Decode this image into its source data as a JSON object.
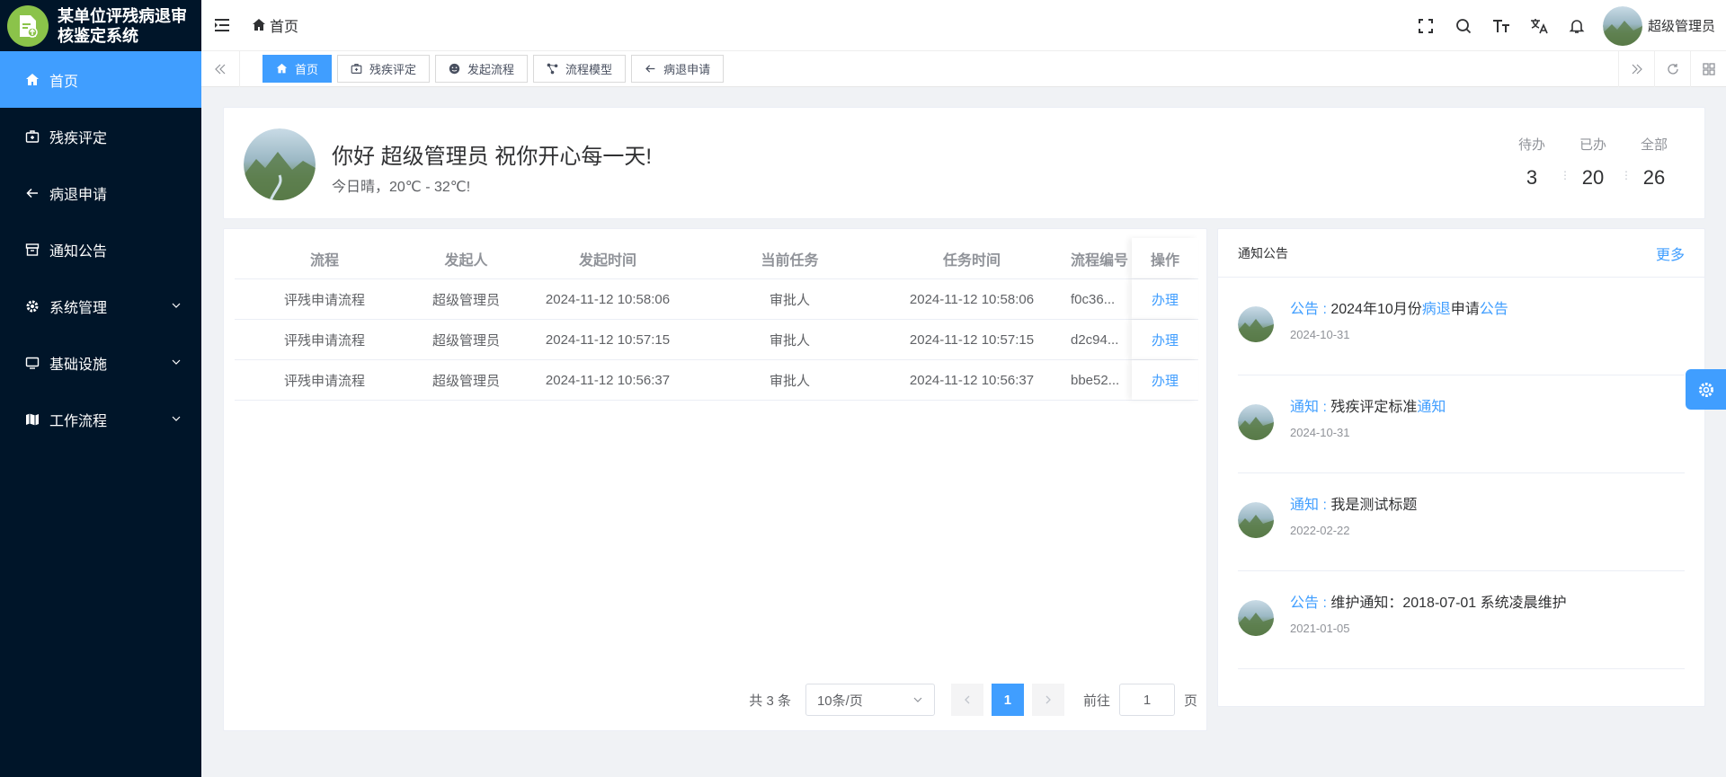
{
  "app": {
    "title": "某单位评残病退审核鉴定系统"
  },
  "sidebar": {
    "items": [
      {
        "label": "首页",
        "icon": "home-icon",
        "active": true
      },
      {
        "label": "残疾评定",
        "icon": "medkit-icon"
      },
      {
        "label": "病退申请",
        "icon": "arrow-left-icon"
      },
      {
        "label": "通知公告",
        "icon": "archive-icon"
      },
      {
        "label": "系统管理",
        "icon": "gear-icon",
        "expandable": true
      },
      {
        "label": "基础设施",
        "icon": "monitor-icon",
        "expandable": true
      },
      {
        "label": "工作流程",
        "icon": "map-icon",
        "expandable": true
      }
    ]
  },
  "header": {
    "breadcrumb": "首页",
    "user_name": "超级管理员",
    "tools": [
      "fullscreen-icon",
      "search-icon",
      "font-size-icon",
      "translate-icon",
      "bell-icon"
    ]
  },
  "tabs": [
    {
      "label": "首页",
      "active": true
    },
    {
      "label": "残疾评定"
    },
    {
      "label": "发起流程"
    },
    {
      "label": "流程模型"
    },
    {
      "label": "病退申请"
    }
  ],
  "welcome": {
    "greeting": "你好 超级管理员 祝你开心每一天!",
    "weather": "今日晴，20℃ - 32℃!",
    "stats": [
      {
        "label": "待办",
        "value": "3"
      },
      {
        "label": "已办",
        "value": "20"
      },
      {
        "label": "全部",
        "value": "26"
      }
    ]
  },
  "table": {
    "columns": [
      "流程",
      "发起人",
      "发起时间",
      "当前任务",
      "任务时间",
      "流程编号",
      "操作"
    ],
    "rows": [
      {
        "process": "评残申请流程",
        "initiator": "超级管理员",
        "start": "2024-11-12 10:58:06",
        "task": "审批人",
        "task_time": "2024-11-12 10:58:06",
        "code": "f0c36...",
        "action": "办理"
      },
      {
        "process": "评残申请流程",
        "initiator": "超级管理员",
        "start": "2024-11-12 10:57:15",
        "task": "审批人",
        "task_time": "2024-11-12 10:57:15",
        "code": "d2c94...",
        "action": "办理"
      },
      {
        "process": "评残申请流程",
        "initiator": "超级管理员",
        "start": "2024-11-12 10:56:37",
        "task": "审批人",
        "task_time": "2024-11-12 10:56:37",
        "code": "bbe52...",
        "action": "办理"
      }
    ],
    "pager": {
      "total": "共 3 条",
      "page_size": "10条/页",
      "current": "1",
      "goto_prefix": "前往",
      "goto_value": "1",
      "goto_suffix": "页"
    }
  },
  "notices": {
    "title": "通知公告",
    "more": "更多",
    "items": [
      {
        "type": "公告",
        "sep": " : ",
        "parts": [
          "2024年10月份",
          "病退",
          "申请",
          "公告"
        ],
        "date": "2024-10-31"
      },
      {
        "type": "通知",
        "sep": " : ",
        "parts": [
          "残疾评定标准",
          "通知"
        ],
        "date": "2024-10-31"
      },
      {
        "type": "通知",
        "sep": " : ",
        "parts": [
          "我是测试标题"
        ],
        "date": "2022-02-22"
      },
      {
        "type": "公告",
        "sep": " : ",
        "parts": [
          "维护通知：2018-07-01 系统凌晨维护"
        ],
        "date": "2021-01-05"
      }
    ]
  },
  "colors": {
    "primary": "#409eff",
    "sidebar": "#001529",
    "logo": "#8bc34a"
  }
}
